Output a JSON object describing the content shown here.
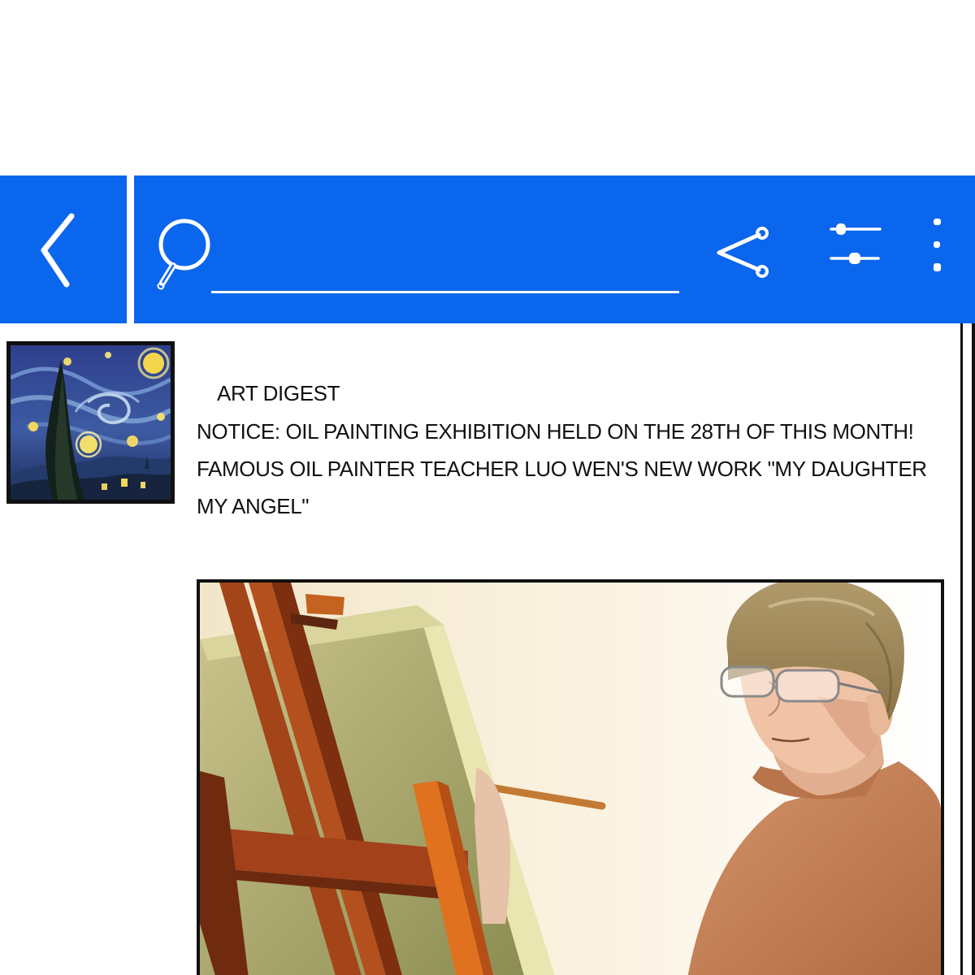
{
  "theme": {
    "accent": "#0b66ee"
  },
  "toolbar": {
    "back_icon": "chevron-left-icon",
    "search_icon": "search-icon",
    "search_value": "",
    "share_icon": "share-icon",
    "filter_icon": "sliders-icon",
    "more_icon": "more-vertical-icon"
  },
  "post": {
    "source": "ART DIGEST",
    "body": "NOTICE: OIL PAINTING EXHIBITION HELD ON THE 28TH OF THIS MONTH! FAMOUS OIL PAINTER TEACHER LUO WEN'S NEW WORK \"MY DAUGHTER MY ANGEL\""
  }
}
